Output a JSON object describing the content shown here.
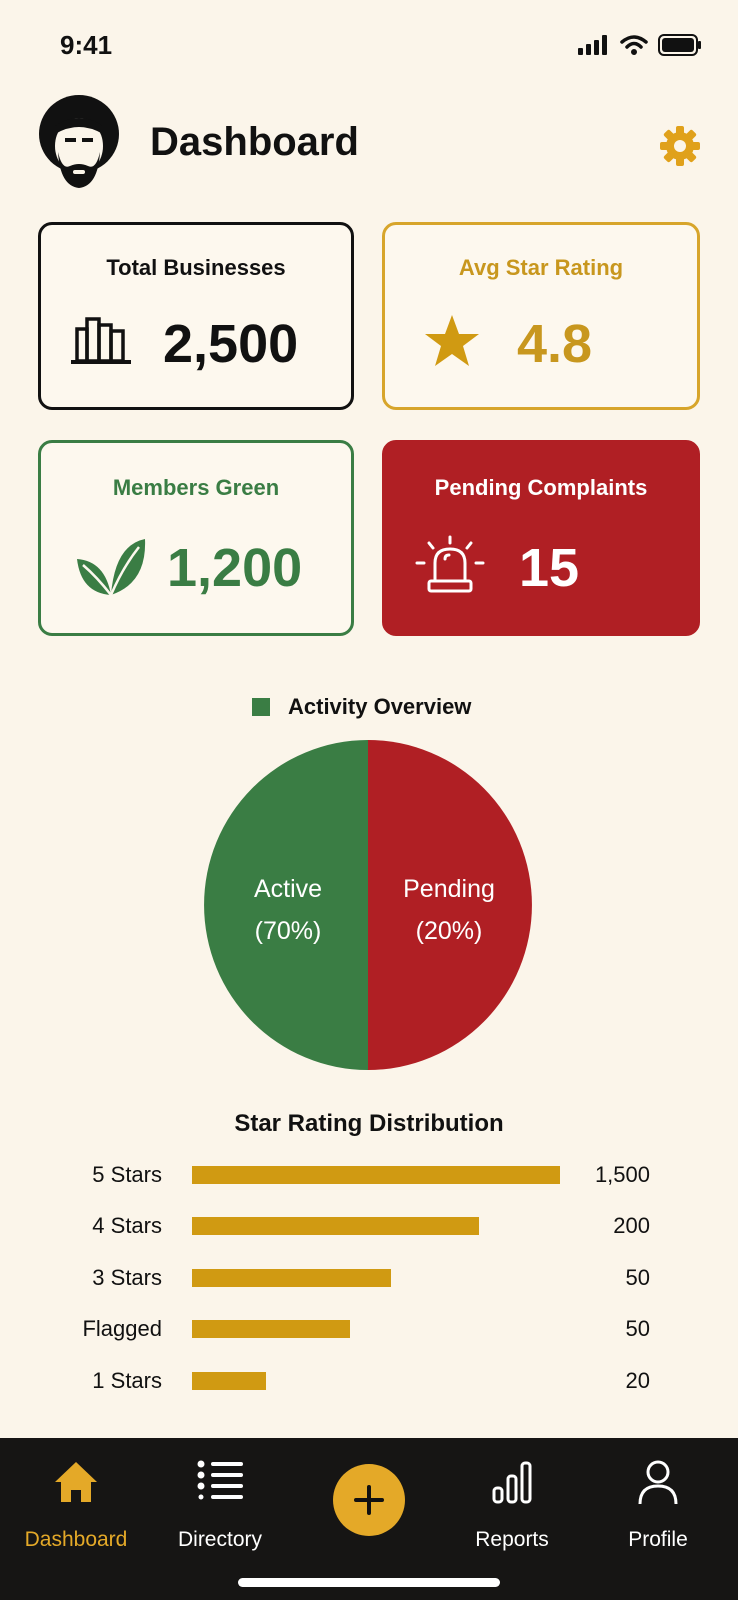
{
  "status_bar": {
    "time": "9:41",
    "icons": [
      "cellular-signal-icon",
      "wifi-icon",
      "battery-icon"
    ]
  },
  "header": {
    "title": "Dashboard",
    "avatar_icon": "user-avatar-icon",
    "settings_icon": "gear-icon"
  },
  "cards": [
    {
      "title": "Total Businesses",
      "value": "2,500",
      "icon": "building-icon"
    },
    {
      "title": "Avg Star Rating",
      "value": "4.8",
      "icon": "star-icon"
    },
    {
      "title": "Members Green",
      "value": "1,200",
      "icon": "leaf-icon"
    },
    {
      "title": "Pending Complaints",
      "value": "15",
      "icon": "alarm-siren-icon"
    }
  ],
  "colors": {
    "background": "#fbf5ea",
    "gold": "#c8971e",
    "green": "#3a7d44",
    "red": "#b01f24",
    "bar": "#d09a12",
    "nav_bg": "#161514",
    "nav_active": "#e4a928"
  },
  "activity": {
    "title": "Activity Overview",
    "slices": [
      {
        "label": "Active",
        "percent_label": "(70%)",
        "value": 70,
        "color": "#3a7d44"
      },
      {
        "label": "Pending",
        "percent_label": "(20%)",
        "value": 20,
        "color": "#b01f24"
      }
    ]
  },
  "star_distribution": {
    "title": "Star Rating Distribution",
    "rows": [
      {
        "label": "5 Stars",
        "value_text": "1,500",
        "fill": 1.0
      },
      {
        "label": "4 Stars",
        "value_text": "200",
        "fill": 0.78
      },
      {
        "label": "3 Stars",
        "value_text": "50",
        "fill": 0.54
      },
      {
        "label": "Flagged",
        "value_text": "50",
        "fill": 0.43
      },
      {
        "label": "1 Stars",
        "value_text": "20",
        "fill": 0.2
      }
    ]
  },
  "bottom_nav": {
    "items": [
      {
        "label": "Dashboard",
        "icon": "home-icon",
        "active": true
      },
      {
        "label": "Directory",
        "icon": "list-icon",
        "active": false
      },
      {
        "label": "",
        "icon": "plus-icon",
        "active": false
      },
      {
        "label": "Reports",
        "icon": "bar-chart-icon",
        "active": false
      },
      {
        "label": "Profile",
        "icon": "person-icon",
        "active": false
      }
    ]
  }
}
